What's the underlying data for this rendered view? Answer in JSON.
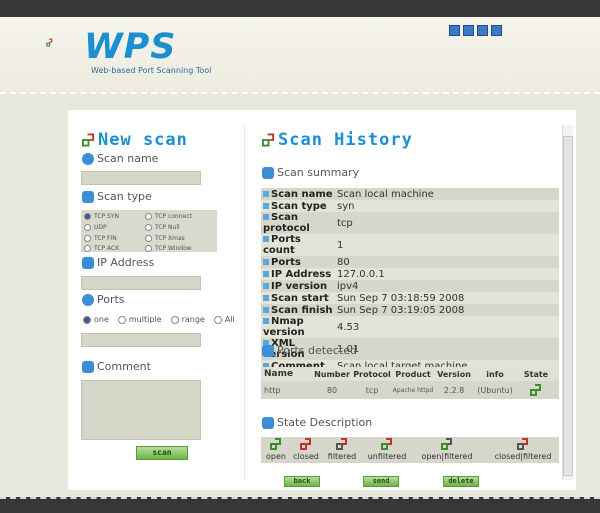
{
  "app": {
    "name": "WPS",
    "tagline": "Web-based Port Scanning Tool"
  },
  "new_scan": {
    "title": "New scan",
    "scan_name_label": "Scan name",
    "scan_name_value": "",
    "scan_type_label": "Scan type",
    "scan_types": [
      {
        "label": "TCP SYN",
        "selected": true
      },
      {
        "label": "TCP connect",
        "selected": false
      },
      {
        "label": "UDP",
        "selected": false
      },
      {
        "label": "TCP Null",
        "selected": false
      },
      {
        "label": "TCP FIN",
        "selected": false
      },
      {
        "label": "TCP Xmas",
        "selected": false
      },
      {
        "label": "TCP ACK",
        "selected": false
      },
      {
        "label": "TCP Window",
        "selected": false
      }
    ],
    "ip_label": "IP Address",
    "ip_value": "",
    "ports_label": "Ports",
    "ports_options": [
      {
        "label": "one",
        "selected": true
      },
      {
        "label": "multiple",
        "selected": false
      },
      {
        "label": "range",
        "selected": false
      },
      {
        "label": "All",
        "selected": false
      }
    ],
    "ports_value": "",
    "comment_label": "Comment",
    "comment_value": "",
    "scan_button": "scan"
  },
  "history": {
    "title": "Scan History",
    "summary_label": "Scan summary",
    "summary": [
      {
        "key": "Scan name",
        "value": "Scan local machine"
      },
      {
        "key": "Scan type",
        "value": "syn"
      },
      {
        "key": "Scan protocol",
        "value": "tcp"
      },
      {
        "key": "Ports count",
        "value": "1"
      },
      {
        "key": "Ports",
        "value": "80"
      },
      {
        "key": "IP Address",
        "value": "127.0.0.1"
      },
      {
        "key": "IP version",
        "value": "ipv4"
      },
      {
        "key": "Scan start",
        "value": "Sun Sep 7 03:18:59 2008"
      },
      {
        "key": "Scan finish",
        "value": "Sun Sep 7 03:19:05 2008"
      },
      {
        "key": "Nmap version",
        "value": "4.53"
      },
      {
        "key": "XML version",
        "value": "1.01"
      },
      {
        "key": "Comment",
        "value": "Scan local target machine"
      }
    ],
    "ports_label": "Ports detected",
    "ports_columns": [
      "Name",
      "Number",
      "Protocol",
      "Product",
      "Version",
      "info",
      "State"
    ],
    "ports_rows": [
      {
        "name": "http",
        "number": "80",
        "protocol": "tcp",
        "product": "Apache httpd",
        "version": "2.2.8",
        "info": "(Ubuntu)"
      }
    ],
    "state_label": "State Description",
    "states": [
      "open",
      "closed",
      "filtered",
      "unfiltered",
      "open|filtered",
      "closed|filtered"
    ],
    "buttons": {
      "back": "back",
      "send": "send",
      "delete": "delete"
    }
  },
  "colors": {
    "accent": "#1b8fd0",
    "button_green": "#6eb34a",
    "logo_red": "#c0342b",
    "logo_green": "#3a8f2a"
  }
}
